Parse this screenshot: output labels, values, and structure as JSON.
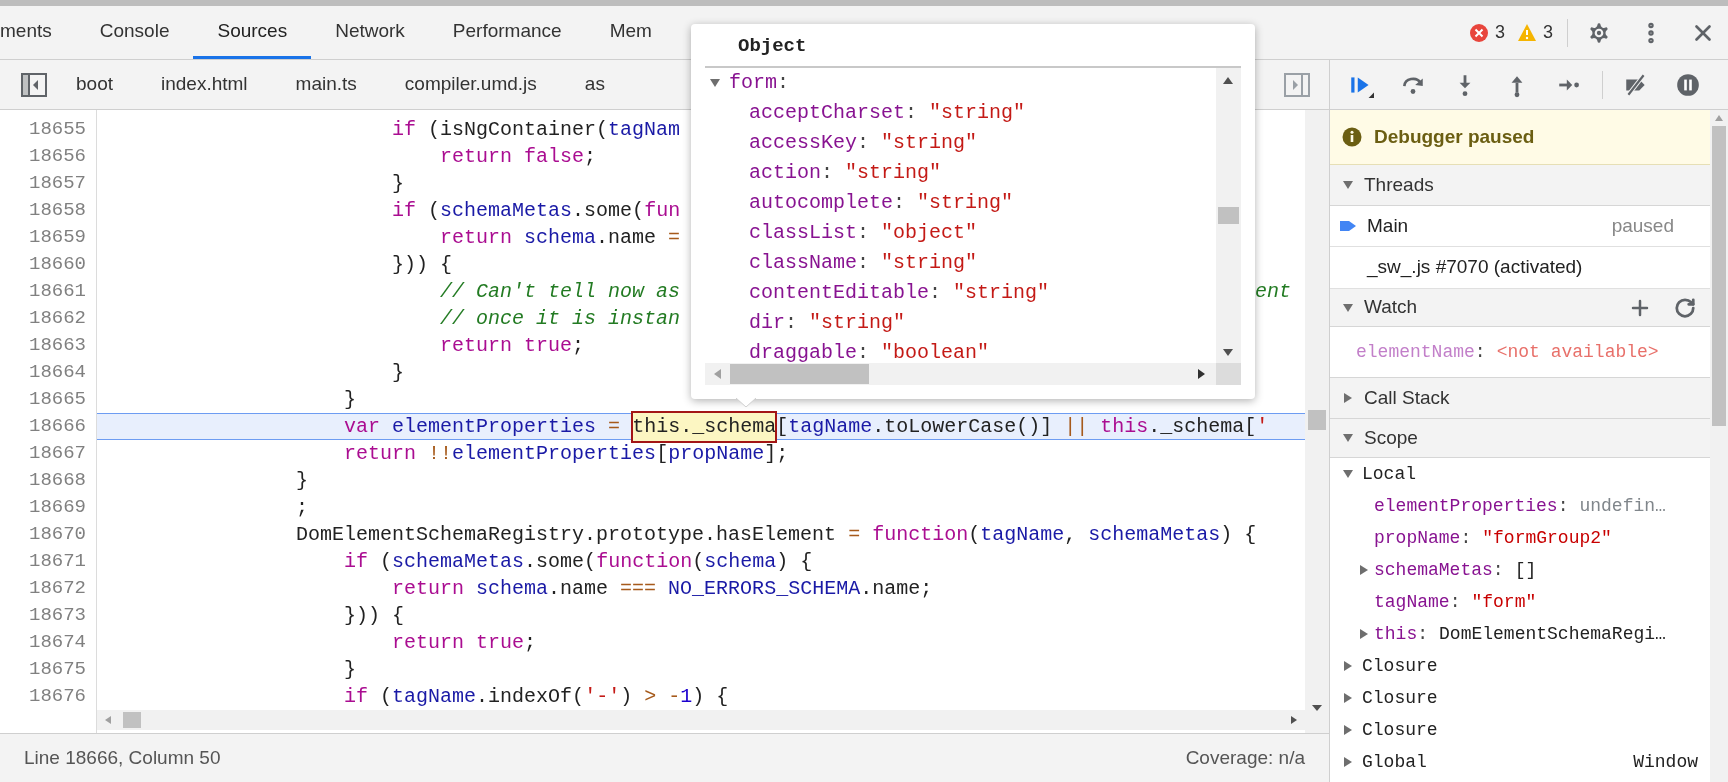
{
  "tabs": [
    {
      "label": "ments",
      "selected": false
    },
    {
      "label": "Console",
      "selected": false
    },
    {
      "label": "Sources",
      "selected": true
    },
    {
      "label": "Network",
      "selected": false
    },
    {
      "label": "Performance",
      "selected": false
    },
    {
      "label": "Mem",
      "selected": false
    }
  ],
  "counters": {
    "errors": "3",
    "warnings": "3"
  },
  "file_tabs": [
    {
      "label": "boot"
    },
    {
      "label": "index.html"
    },
    {
      "label": "main.ts"
    },
    {
      "label": "compiler.umd.js"
    },
    {
      "label": "as"
    }
  ],
  "editor": {
    "lines": [
      {
        "number": "18655",
        "current": false,
        "tokens": [
          {
            "text": "                        if",
            "kind": "kw"
          },
          {
            "text": " (isNgContainer(",
            "kind": "plain"
          },
          {
            "text": "tagNam",
            "kind": "id"
          }
        ]
      },
      {
        "number": "18656",
        "current": false,
        "tokens": [
          {
            "text": "                            return false",
            "kind": "kw"
          },
          {
            "text": ";",
            "kind": "plain"
          }
        ]
      },
      {
        "number": "18657",
        "current": false,
        "tokens": [
          {
            "text": "                        }",
            "kind": "plain"
          }
        ]
      },
      {
        "number": "18658",
        "current": false,
        "tokens": [
          {
            "text": "                        if",
            "kind": "kw"
          },
          {
            "text": " (",
            "kind": "plain"
          },
          {
            "text": "schemaMetas",
            "kind": "id"
          },
          {
            "text": ".some(",
            "kind": "plain"
          },
          {
            "text": "fun",
            "kind": "kw"
          }
        ]
      },
      {
        "number": "18659",
        "current": false,
        "tokens": [
          {
            "text": "                            return ",
            "kind": "kw"
          },
          {
            "text": "schema",
            "kind": "id"
          },
          {
            "text": ".name ",
            "kind": "plain"
          },
          {
            "text": "=",
            "kind": "op"
          }
        ]
      },
      {
        "number": "18660",
        "current": false,
        "tokens": [
          {
            "text": "                        })) {",
            "kind": "plain"
          }
        ]
      },
      {
        "number": "18661",
        "current": false,
        "tokens": [
          {
            "text": "                            // Can't tell now as",
            "kind": "comment"
          }
        ],
        "tail": {
          "text": "ent",
          "kind": "comment"
        }
      },
      {
        "number": "18662",
        "current": false,
        "tokens": [
          {
            "text": "                            // once it is instan",
            "kind": "comment"
          }
        ]
      },
      {
        "number": "18663",
        "current": false,
        "tokens": [
          {
            "text": "                            return true",
            "kind": "kw"
          },
          {
            "text": ";",
            "kind": "plain"
          }
        ]
      },
      {
        "number": "18664",
        "current": false,
        "tokens": [
          {
            "text": "                        }",
            "kind": "plain"
          }
        ]
      },
      {
        "number": "18665",
        "current": false,
        "tokens": [
          {
            "text": "                    }",
            "kind": "plain"
          }
        ]
      },
      {
        "number": "18666",
        "current": true,
        "tokens": [
          {
            "text": "                    var ",
            "kind": "kw"
          },
          {
            "text": "elementProperties ",
            "kind": "id"
          },
          {
            "text": "= ",
            "kind": "op"
          },
          {
            "text": "this._schema",
            "kind": "hovered"
          },
          {
            "text": "[",
            "kind": "plain"
          },
          {
            "text": "tagName",
            "kind": "id"
          },
          {
            "text": ".toLowerCase()] ",
            "kind": "plain"
          },
          {
            "text": "|| ",
            "kind": "op"
          },
          {
            "text": "this",
            "kind": "kw"
          },
          {
            "text": "._schema[",
            "kind": "plain"
          },
          {
            "text": "'",
            "kind": "str"
          }
        ]
      },
      {
        "number": "18667",
        "current": false,
        "tokens": [
          {
            "text": "                    return ",
            "kind": "kw"
          },
          {
            "text": "!!",
            "kind": "op"
          },
          {
            "text": "elementProperties",
            "kind": "id"
          },
          {
            "text": "[",
            "kind": "plain"
          },
          {
            "text": "propName",
            "kind": "id"
          },
          {
            "text": "];",
            "kind": "plain"
          }
        ]
      },
      {
        "number": "18668",
        "current": false,
        "tokens": [
          {
            "text": "                }",
            "kind": "plain"
          }
        ]
      },
      {
        "number": "18669",
        "current": false,
        "tokens": [
          {
            "text": "                ;",
            "kind": "plain"
          }
        ]
      },
      {
        "number": "18670",
        "current": false,
        "tokens": [
          {
            "text": "                DomElementSchemaRegistry.prototype.hasElement ",
            "kind": "plain"
          },
          {
            "text": "= ",
            "kind": "op"
          },
          {
            "text": "function",
            "kind": "kw"
          },
          {
            "text": "(",
            "kind": "plain"
          },
          {
            "text": "tagName",
            "kind": "id"
          },
          {
            "text": ", ",
            "kind": "plain"
          },
          {
            "text": "schemaMetas",
            "kind": "id"
          },
          {
            "text": ") {",
            "kind": "plain"
          }
        ]
      },
      {
        "number": "18671",
        "current": false,
        "tokens": [
          {
            "text": "                    if",
            "kind": "kw"
          },
          {
            "text": " (",
            "kind": "plain"
          },
          {
            "text": "schemaMetas",
            "kind": "id"
          },
          {
            "text": ".some(",
            "kind": "plain"
          },
          {
            "text": "function",
            "kind": "kw"
          },
          {
            "text": "(",
            "kind": "plain"
          },
          {
            "text": "schema",
            "kind": "id"
          },
          {
            "text": ") {",
            "kind": "plain"
          }
        ]
      },
      {
        "number": "18672",
        "current": false,
        "tokens": [
          {
            "text": "                        return ",
            "kind": "kw"
          },
          {
            "text": "schema",
            "kind": "id"
          },
          {
            "text": ".name ",
            "kind": "plain"
          },
          {
            "text": "=== ",
            "kind": "op"
          },
          {
            "text": "NO_ERRORS_SCHEMA",
            "kind": "id"
          },
          {
            "text": ".name;",
            "kind": "plain"
          }
        ]
      },
      {
        "number": "18673",
        "current": false,
        "tokens": [
          {
            "text": "                    })) {",
            "kind": "plain"
          }
        ]
      },
      {
        "number": "18674",
        "current": false,
        "tokens": [
          {
            "text": "                        return true",
            "kind": "kw"
          },
          {
            "text": ";",
            "kind": "plain"
          }
        ]
      },
      {
        "number": "18675",
        "current": false,
        "tokens": [
          {
            "text": "                    }",
            "kind": "plain"
          }
        ]
      },
      {
        "number": "18676",
        "current": false,
        "tokens": [
          {
            "text": "                    if",
            "kind": "kw"
          },
          {
            "text": " (",
            "kind": "plain"
          },
          {
            "text": "tagName",
            "kind": "id"
          },
          {
            "text": ".indexOf(",
            "kind": "plain"
          },
          {
            "text": "'-'",
            "kind": "str"
          },
          {
            "text": ") ",
            "kind": "plain"
          },
          {
            "text": "> -",
            "kind": "op"
          },
          {
            "text": "1",
            "kind": "num"
          },
          {
            "text": ") {",
            "kind": "plain"
          }
        ]
      }
    ],
    "status_left": "Line 18666, Column 50",
    "status_right": "Coverage: n/a"
  },
  "popup": {
    "title": "Object",
    "root": {
      "key": "form:",
      "expanded": true,
      "children": [
        {
          "key": "acceptCharset:",
          "value": "\"string\""
        },
        {
          "key": "accessKey:",
          "value": "\"string\""
        },
        {
          "key": "action:",
          "value": "\"string\""
        },
        {
          "key": "autocomplete:",
          "value": "\"string\""
        },
        {
          "key": "classList:",
          "value": "\"object\""
        },
        {
          "key": "className:",
          "value": "\"string\""
        },
        {
          "key": "contentEditable:",
          "value": "\"string\""
        },
        {
          "key": "dir:",
          "value": "\"string\""
        },
        {
          "key": "draggable:",
          "value": "\"boolean\""
        }
      ]
    }
  },
  "debugger": {
    "banner": "Debugger paused",
    "threads": {
      "title": "Threads",
      "expanded": true,
      "items": [
        {
          "name": "Main",
          "status": "paused",
          "current": true
        },
        {
          "name": "_sw_.js #7070 (activated)",
          "current": false
        }
      ]
    },
    "watch": {
      "title": "Watch",
      "expanded": true,
      "items": [
        {
          "name": "elementName:",
          "value": "<not available>"
        }
      ]
    },
    "call_stack": {
      "title": "Call Stack",
      "expanded": false
    },
    "scope": {
      "title": "Scope",
      "expanded": true,
      "groups": [
        {
          "name": "Local",
          "expanded": true,
          "children": [
            {
              "key": "elementProperties:",
              "value": "undefin…",
              "kind": "undefined",
              "expandable": false
            },
            {
              "key": "propName:",
              "value": "\"formGroup2\"",
              "kind": "string",
              "expandable": false
            },
            {
              "key": "schemaMetas:",
              "value": "[]",
              "kind": "object",
              "expandable": true
            },
            {
              "key": "tagName:",
              "value": "\"form\"",
              "kind": "string",
              "expandable": false
            },
            {
              "key": "this:",
              "value": "DomElementSchemaRegi…",
              "kind": "object",
              "expandable": true
            }
          ]
        },
        {
          "name": "Closure",
          "expanded": false
        },
        {
          "name": "Closure",
          "expanded": false
        },
        {
          "name": "Closure",
          "expanded": false
        },
        {
          "name": "Global",
          "expanded": false,
          "value": "Window"
        }
      ]
    }
  }
}
